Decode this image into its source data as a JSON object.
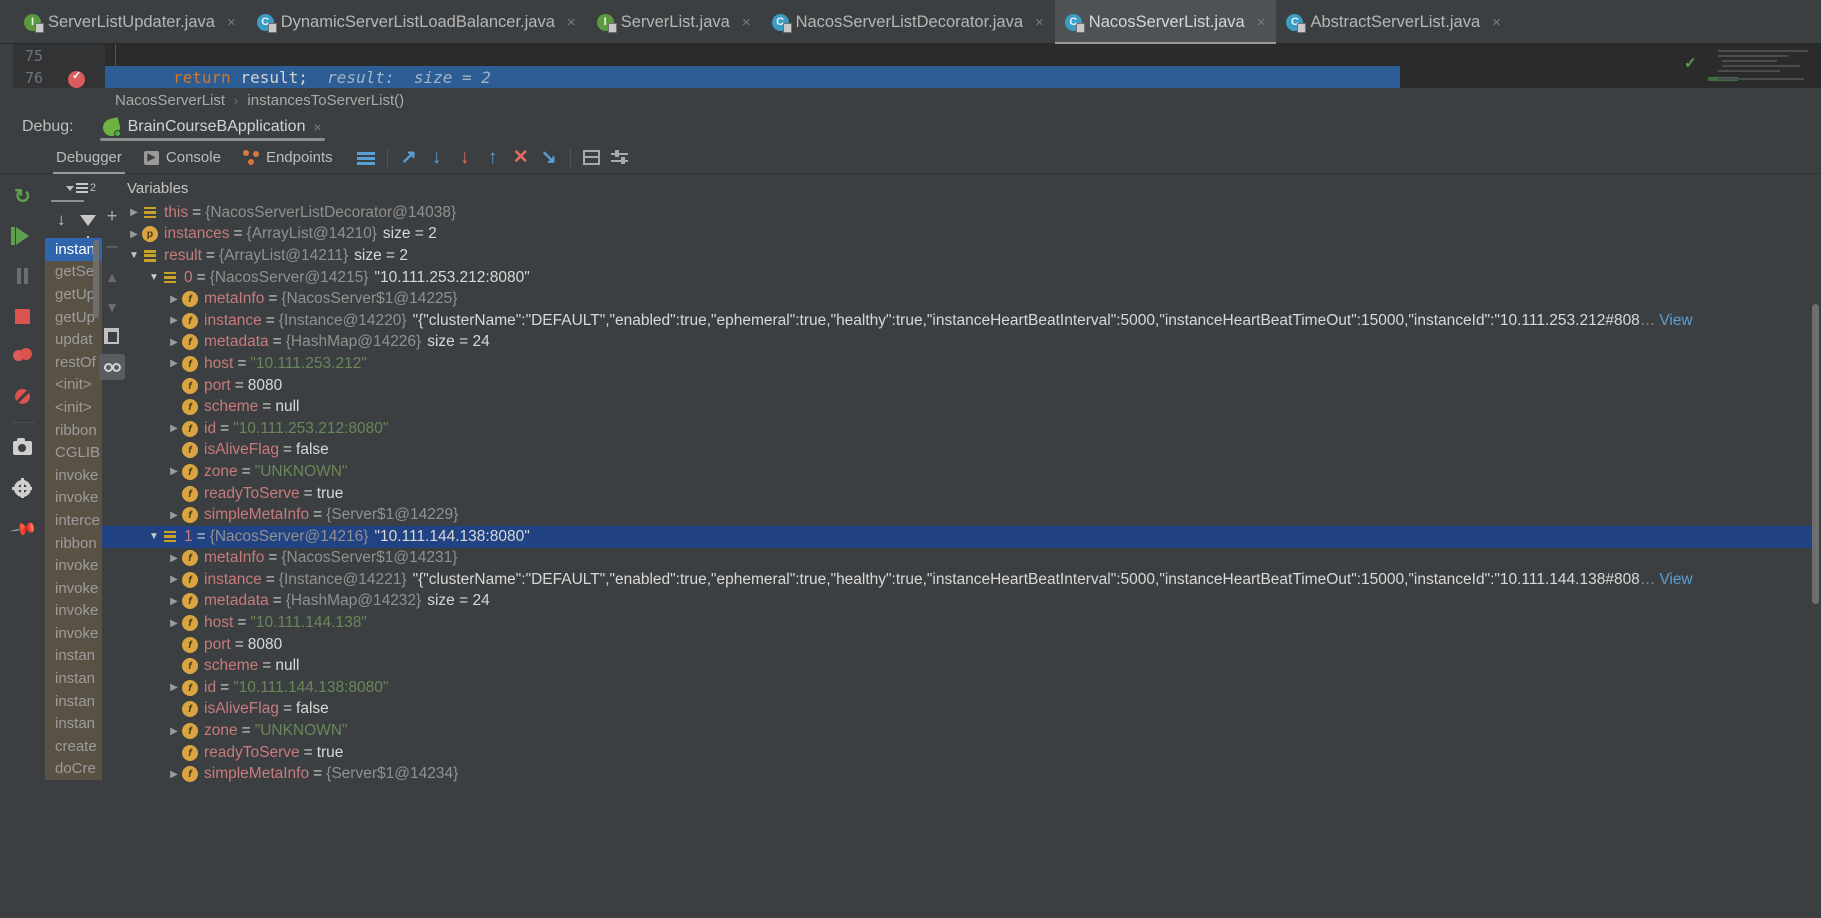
{
  "editor_tabs": [
    {
      "label": "ServerListUpdater.java",
      "icon": "interface-icon",
      "kind": "iface",
      "active": false
    },
    {
      "label": "DynamicServerListLoadBalancer.java",
      "icon": "class-icon",
      "kind": "cls",
      "active": false
    },
    {
      "label": "ServerList.java",
      "icon": "interface-icon",
      "kind": "iface",
      "active": false
    },
    {
      "label": "NacosServerListDecorator.java",
      "icon": "class-icon",
      "kind": "cls",
      "active": false
    },
    {
      "label": "NacosServerList.java",
      "icon": "class-icon",
      "kind": "cls",
      "active": true
    },
    {
      "label": "AbstractServerList.java",
      "icon": "class-icon",
      "kind": "cls",
      "active": false
    }
  ],
  "tab_close_glyph": "×",
  "editor": {
    "line_numbers": [
      "75",
      "76"
    ],
    "code_keyword": "return",
    "code_identifier": " result;",
    "code_hint": "  result:  size = 2",
    "breakpoint_tooltip": "breakpoint-verified"
  },
  "breadcrumb": {
    "class": "NacosServerList",
    "separator": "›",
    "method": "instancesToServerList()"
  },
  "debug_header": {
    "label": "Debug:",
    "session": "BrainCourseBApplication",
    "close_glyph": "×"
  },
  "debug_tabs": [
    {
      "label": "Debugger",
      "icon": "none",
      "active": true
    },
    {
      "label": "Console",
      "icon": "console-icon",
      "active": false
    },
    {
      "label": "Endpoints",
      "icon": "endpoints-icon",
      "active": false
    }
  ],
  "debug_toolbar": [
    {
      "name": "layout-icon",
      "glyph": ""
    },
    {
      "name": "step-over-icon",
      "glyph": "↗"
    },
    {
      "name": "step-into-icon",
      "glyph": "↓"
    },
    {
      "name": "force-step-into-icon",
      "glyph": "↓"
    },
    {
      "name": "step-out-icon",
      "glyph": "↑"
    },
    {
      "name": "drop-frame-icon",
      "glyph": "✕"
    },
    {
      "name": "run-to-cursor-icon",
      "glyph": "↘"
    },
    {
      "name": "evaluate-expression-icon",
      "glyph": ""
    },
    {
      "name": "settings-icon",
      "glyph": ""
    }
  ],
  "session_rail": [
    {
      "name": "rerun-button",
      "glyph": "↻"
    },
    {
      "name": "resume-program-button",
      "glyph": "▶"
    },
    {
      "name": "pause-program-button",
      "glyph": "⏸"
    },
    {
      "name": "stop-button",
      "glyph": "■"
    },
    {
      "name": "view-breakpoints-button",
      "glyph": "●"
    },
    {
      "name": "mute-breakpoints-button",
      "glyph": "⊘"
    },
    {
      "name": "get-thread-dump-button",
      "glyph": "▣"
    },
    {
      "name": "settings-button",
      "glyph": "⚙"
    },
    {
      "name": "pin-tab-button",
      "glyph": "📌"
    }
  ],
  "frames": {
    "thread_count": "2",
    "items": [
      {
        "label": "instan",
        "selected": true
      },
      {
        "label": "getSe",
        "selected": false
      },
      {
        "label": "getUp",
        "selected": false
      },
      {
        "label": "getUp",
        "selected": false
      },
      {
        "label": "updat",
        "selected": false
      },
      {
        "label": "restOf",
        "selected": false
      },
      {
        "label": "<init>",
        "selected": false
      },
      {
        "label": "<init>",
        "selected": false
      },
      {
        "label": "ribbon",
        "selected": false
      },
      {
        "label": "CGLIB",
        "selected": false
      },
      {
        "label": "invoke",
        "selected": false
      },
      {
        "label": "invoke",
        "selected": false
      },
      {
        "label": "interce",
        "selected": false
      },
      {
        "label": "ribbon",
        "selected": false
      },
      {
        "label": "invoke",
        "selected": false
      },
      {
        "label": "invoke",
        "selected": false
      },
      {
        "label": "invoke",
        "selected": false
      },
      {
        "label": "invoke",
        "selected": false
      },
      {
        "label": "instan",
        "selected": false
      },
      {
        "label": "instan",
        "selected": false
      },
      {
        "label": "instan",
        "selected": false
      },
      {
        "label": "instan",
        "selected": false
      },
      {
        "label": "create",
        "selected": false
      },
      {
        "label": "doCre",
        "selected": false
      }
    ]
  },
  "variables_panel": {
    "title": "Variables",
    "tools": [
      {
        "name": "add-watch-button",
        "glyph": "+",
        "state": "normal"
      },
      {
        "name": "remove-watch-button",
        "glyph": "–",
        "state": "dim"
      },
      {
        "name": "move-up-button",
        "glyph": "▲",
        "state": "dim"
      },
      {
        "name": "move-down-button",
        "glyph": "▼",
        "state": "dim"
      },
      {
        "name": "copy-value-button",
        "glyph": "",
        "state": "normal"
      },
      {
        "name": "inspect-button",
        "glyph": "",
        "state": "on"
      }
    ],
    "rows": [
      {
        "indent": 0,
        "twisty": "collapsed",
        "icon": "list",
        "name": "this",
        "eq": "=",
        "type": "{NacosServerListDecorator@14038}",
        "value": "",
        "value_kind": "none",
        "size": "",
        "selected": false
      },
      {
        "indent": 0,
        "twisty": "collapsed",
        "icon": "p",
        "name": "instances",
        "eq": "=",
        "type": "{ArrayList@14210}",
        "value": "",
        "value_kind": "none",
        "size": "size = 2",
        "selected": false
      },
      {
        "indent": 0,
        "twisty": "expanded",
        "icon": "list",
        "name": "result",
        "eq": "=",
        "type": "{ArrayList@14211}",
        "value": "",
        "value_kind": "none",
        "size": "size = 2",
        "selected": false
      },
      {
        "indent": 1,
        "twisty": "expanded",
        "icon": "list",
        "name": "0",
        "eq": "=",
        "type": "{NacosServer@14215}",
        "value": "\"10.111.253.212:8080\"",
        "value_kind": "plain",
        "size": "",
        "selected": false,
        "name_kind": "index"
      },
      {
        "indent": 2,
        "twisty": "collapsed",
        "icon": "f",
        "name": "metaInfo",
        "eq": "=",
        "type": "{NacosServer$1@14225}",
        "value": "",
        "value_kind": "none",
        "size": "",
        "selected": false
      },
      {
        "indent": 2,
        "twisty": "collapsed",
        "icon": "f",
        "name": "instance",
        "eq": "=",
        "type": "{Instance@14220}",
        "value": "\"{\"clusterName\":\"DEFAULT\",\"enabled\":true,\"ephemeral\":true,\"healthy\":true,\"instanceHeartBeatInterval\":5000,\"instanceHeartBeatTimeOut\":15000,\"instanceId\":\"10.111.253.212#808",
        "value_kind": "json",
        "ellipsis": "…",
        "link": "View",
        "size": "",
        "selected": false
      },
      {
        "indent": 2,
        "twisty": "collapsed",
        "icon": "f",
        "name": "metadata",
        "eq": "=",
        "type": "{HashMap@14226}",
        "value": "",
        "value_kind": "none",
        "size": "size = 24",
        "selected": false
      },
      {
        "indent": 2,
        "twisty": "collapsed",
        "icon": "f",
        "name": "host",
        "eq": "=",
        "type": "",
        "value": "\"10.111.253.212\"",
        "value_kind": "string",
        "size": "",
        "selected": false
      },
      {
        "indent": 2,
        "twisty": "none",
        "icon": "f",
        "name": "port",
        "eq": "=",
        "type": "",
        "value": "8080",
        "value_kind": "number",
        "size": "",
        "selected": false
      },
      {
        "indent": 2,
        "twisty": "none",
        "icon": "f",
        "name": "scheme",
        "eq": "=",
        "type": "",
        "value": "null",
        "value_kind": "number",
        "size": "",
        "selected": false
      },
      {
        "indent": 2,
        "twisty": "collapsed",
        "icon": "f",
        "name": "id",
        "eq": "=",
        "type": "",
        "value": "\"10.111.253.212:8080\"",
        "value_kind": "string",
        "size": "",
        "selected": false
      },
      {
        "indent": 2,
        "twisty": "none",
        "icon": "f",
        "name": "isAliveFlag",
        "eq": "=",
        "type": "",
        "value": "false",
        "value_kind": "number",
        "size": "",
        "selected": false
      },
      {
        "indent": 2,
        "twisty": "collapsed",
        "icon": "f",
        "name": "zone",
        "eq": "=",
        "type": "",
        "value": "\"UNKNOWN\"",
        "value_kind": "string",
        "size": "",
        "selected": false
      },
      {
        "indent": 2,
        "twisty": "none",
        "icon": "f",
        "name": "readyToServe",
        "eq": "=",
        "type": "",
        "value": "true",
        "value_kind": "number",
        "size": "",
        "selected": false
      },
      {
        "indent": 2,
        "twisty": "collapsed",
        "icon": "f",
        "name": "simpleMetaInfo",
        "eq": "=",
        "type": "{Server$1@14229}",
        "value": "",
        "value_kind": "none",
        "size": "",
        "selected": false
      },
      {
        "indent": 1,
        "twisty": "expanded",
        "icon": "list",
        "name": "1",
        "eq": "=",
        "type": "{NacosServer@14216}",
        "value": "\"10.111.144.138:8080\"",
        "value_kind": "plain",
        "size": "",
        "selected": true,
        "name_kind": "index"
      },
      {
        "indent": 2,
        "twisty": "collapsed",
        "icon": "f",
        "name": "metaInfo",
        "eq": "=",
        "type": "{NacosServer$1@14231}",
        "value": "",
        "value_kind": "none",
        "size": "",
        "selected": false
      },
      {
        "indent": 2,
        "twisty": "collapsed",
        "icon": "f",
        "name": "instance",
        "eq": "=",
        "type": "{Instance@14221}",
        "value": "\"{\"clusterName\":\"DEFAULT\",\"enabled\":true,\"ephemeral\":true,\"healthy\":true,\"instanceHeartBeatInterval\":5000,\"instanceHeartBeatTimeOut\":15000,\"instanceId\":\"10.111.144.138#808",
        "value_kind": "json",
        "ellipsis": "…",
        "link": "View",
        "size": "",
        "selected": false
      },
      {
        "indent": 2,
        "twisty": "collapsed",
        "icon": "f",
        "name": "metadata",
        "eq": "=",
        "type": "{HashMap@14232}",
        "value": "",
        "value_kind": "none",
        "size": "size = 24",
        "selected": false
      },
      {
        "indent": 2,
        "twisty": "collapsed",
        "icon": "f",
        "name": "host",
        "eq": "=",
        "type": "",
        "value": "\"10.111.144.138\"",
        "value_kind": "string",
        "size": "",
        "selected": false
      },
      {
        "indent": 2,
        "twisty": "none",
        "icon": "f",
        "name": "port",
        "eq": "=",
        "type": "",
        "value": "8080",
        "value_kind": "number",
        "size": "",
        "selected": false
      },
      {
        "indent": 2,
        "twisty": "none",
        "icon": "f",
        "name": "scheme",
        "eq": "=",
        "type": "",
        "value": "null",
        "value_kind": "number",
        "size": "",
        "selected": false
      },
      {
        "indent": 2,
        "twisty": "collapsed",
        "icon": "f",
        "name": "id",
        "eq": "=",
        "type": "",
        "value": "\"10.111.144.138:8080\"",
        "value_kind": "string",
        "size": "",
        "selected": false
      },
      {
        "indent": 2,
        "twisty": "none",
        "icon": "f",
        "name": "isAliveFlag",
        "eq": "=",
        "type": "",
        "value": "false",
        "value_kind": "number",
        "size": "",
        "selected": false
      },
      {
        "indent": 2,
        "twisty": "collapsed",
        "icon": "f",
        "name": "zone",
        "eq": "=",
        "type": "",
        "value": "\"UNKNOWN\"",
        "value_kind": "string",
        "size": "",
        "selected": false
      },
      {
        "indent": 2,
        "twisty": "none",
        "icon": "f",
        "name": "readyToServe",
        "eq": "=",
        "type": "",
        "value": "true",
        "value_kind": "number",
        "size": "",
        "selected": false
      },
      {
        "indent": 2,
        "twisty": "collapsed",
        "icon": "f",
        "name": "simpleMetaInfo",
        "eq": "=",
        "type": "{Server$1@14234}",
        "value": "",
        "value_kind": "none",
        "size": "",
        "selected": false
      }
    ]
  },
  "colors": {
    "accent_blue": "#2c5d94",
    "selection_blue": "#214283",
    "string_green": "#6a8759",
    "name_red": "#c77b7b",
    "keyword_orange": "#cc7832",
    "frame_olive": "#595144"
  }
}
